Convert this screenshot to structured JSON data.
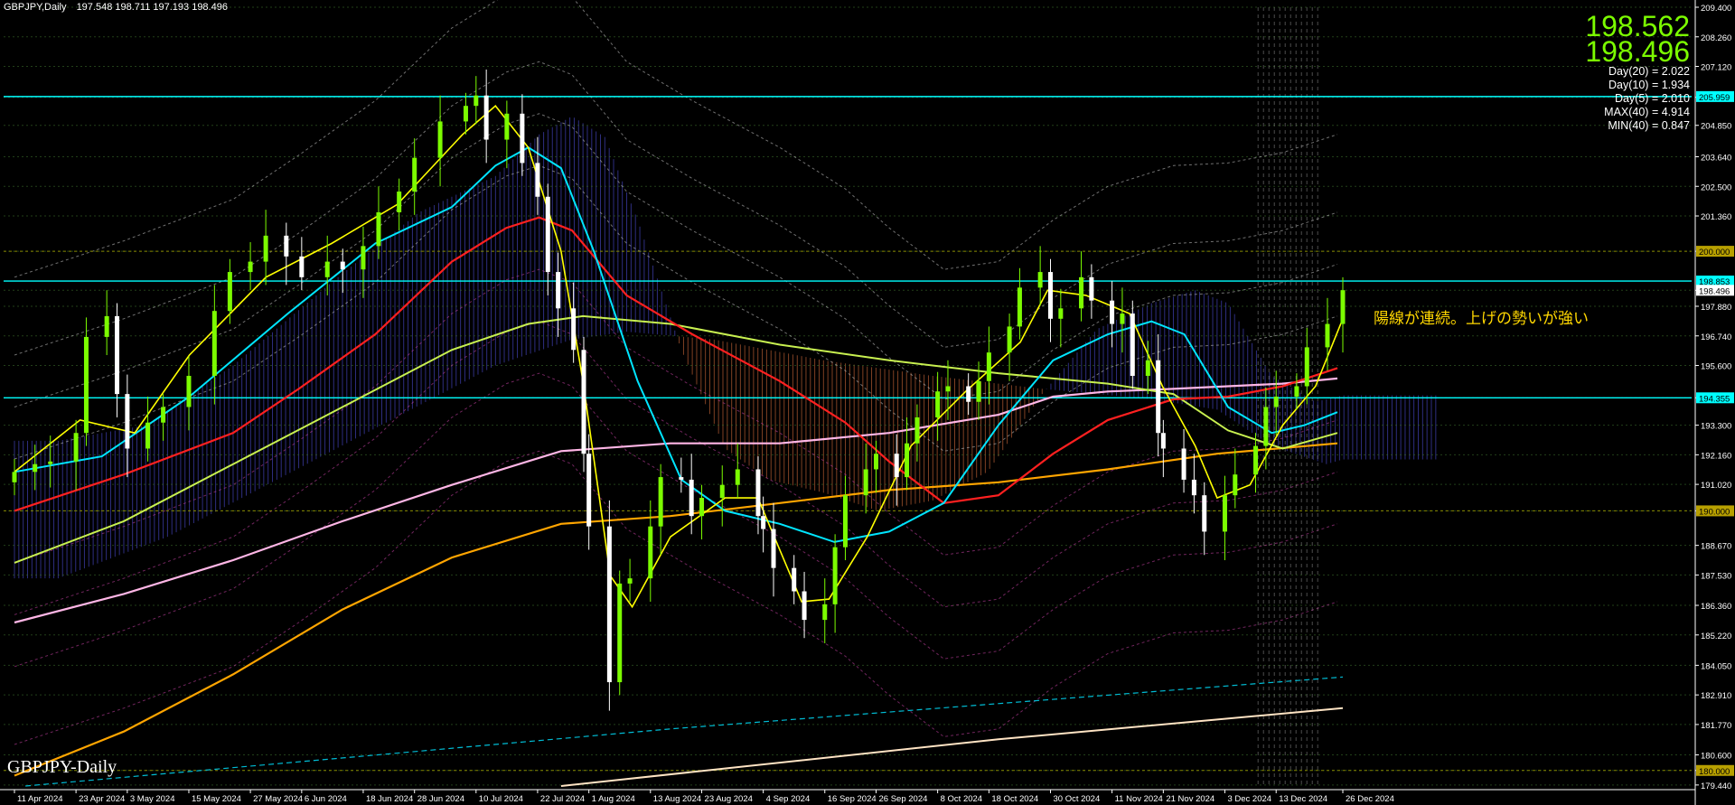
{
  "header": {
    "symbol": "GBPJPY,Daily",
    "ohlc": "197.548 198.711 197.193 198.496"
  },
  "price_box": {
    "bid": "198.562",
    "ask": "198.496"
  },
  "stats": [
    "Day(20) = 2.022",
    "Day(10) = 1.934",
    "Day(5) = 2.010",
    "MAX(40) = 4.914",
    "MIN(40) = 0.847"
  ],
  "annotation": "陽線が連続。上げの勢いが強い",
  "watermark": "GBPJPY-Daily",
  "colors": {
    "background": "#000000",
    "bull": "#7cfc00",
    "bear": "#ffffff",
    "sma_fast": "#ffff00",
    "sma_cyan": "#00e5ff",
    "sma_red": "#ff2020",
    "sma_lime": "#c8f050",
    "sma_pink": "#ffb6e6",
    "sma_orange": "#ffa500",
    "level_line": "#00ffff",
    "cloud_bull": "#3a3aa0",
    "cloud_bear": "#a0522d"
  },
  "chart_data": {
    "type": "candlestick",
    "symbol": "GBPJPY",
    "timeframe": "Daily",
    "ylim": [
      179.4,
      209.4
    ],
    "y_ticks": [
      "209.400",
      "208.260",
      "207.120",
      "205.930",
      "204.850",
      "203.640",
      "202.500",
      "201.360",
      "200.000",
      "198.496",
      "197.880",
      "196.740",
      "195.600",
      "194.355",
      "193.300",
      "192.160",
      "191.020",
      "190.000",
      "188.670",
      "187.530",
      "186.360",
      "185.220",
      "184.050",
      "182.910",
      "181.770",
      "180.600",
      "180.000",
      "179.440"
    ],
    "highlighted_levels": [
      "205.959",
      "200.000",
      "198.853",
      "198.496",
      "194.355",
      "190.000",
      "180.000"
    ],
    "x_labels": [
      "11 Apr 2024",
      "23 Apr 2024",
      "3 May 2024",
      "15 May 2024",
      "27 May 2024",
      "6 Jun 2024",
      "18 Jun 2024",
      "28 Jun 2024",
      "10 Jul 2024",
      "22 Jul 2024",
      "1 Aug 2024",
      "13 Aug 2024",
      "23 Aug 2024",
      "4 Sep 2024",
      "16 Sep 2024",
      "26 Sep 2024",
      "8 Oct 2024",
      "18 Oct 2024",
      "30 Oct 2024",
      "11 Nov 2024",
      "21 Nov 2024",
      "3 Dec 2024",
      "13 Dec 2024",
      "26 Dec 2024"
    ],
    "close_path": [
      [
        "11 Apr 2024",
        191.5
      ],
      [
        "15 Apr 2024",
        191.8
      ],
      [
        "18 Apr 2024",
        191.9
      ],
      [
        "23 Apr 2024",
        193.0
      ],
      [
        "25 Apr 2024",
        196.7
      ],
      [
        "29 Apr 2024",
        197.5
      ],
      [
        "1 May 2024",
        194.5
      ],
      [
        "3 May 2024",
        192.4
      ],
      [
        "7 May 2024",
        193.4
      ],
      [
        "10 May 2024",
        194.0
      ],
      [
        "15 May 2024",
        195.2
      ],
      [
        "20 May 2024",
        197.7
      ],
      [
        "23 May 2024",
        199.2
      ],
      [
        "27 May 2024",
        199.6
      ],
      [
        "30 May 2024",
        200.6
      ],
      [
        "3 Jun 2024",
        199.8
      ],
      [
        "6 Jun 2024",
        199.0
      ],
      [
        "11 Jun 2024",
        199.6
      ],
      [
        "14 Jun 2024",
        199.3
      ],
      [
        "18 Jun 2024",
        200.2
      ],
      [
        "21 Jun 2024",
        201.5
      ],
      [
        "25 Jun 2024",
        202.3
      ],
      [
        "28 Jun 2024",
        203.6
      ],
      [
        "3 Jul 2024",
        205.0
      ],
      [
        "8 Jul 2024",
        205.6
      ],
      [
        "10 Jul 2024",
        206.0
      ],
      [
        "12 Jul 2024",
        204.3
      ],
      [
        "16 Jul 2024",
        205.3
      ],
      [
        "19 Jul 2024",
        203.4
      ],
      [
        "22 Jul 2024",
        202.1
      ],
      [
        "24 Jul 2024",
        199.2
      ],
      [
        "26 Jul 2024",
        197.8
      ],
      [
        "29 Jul 2024",
        196.2
      ],
      [
        "31 Jul 2024",
        192.2
      ],
      [
        "1 Aug 2024",
        189.4
      ],
      [
        "5 Aug 2024",
        183.4
      ],
      [
        "7 Aug 2024",
        187.2
      ],
      [
        "9 Aug 2024",
        187.4
      ],
      [
        "13 Aug 2024",
        189.4
      ],
      [
        "15 Aug 2024",
        191.3
      ],
      [
        "19 Aug 2024",
        191.2
      ],
      [
        "21 Aug 2024",
        189.8
      ],
      [
        "23 Aug 2024",
        190.5
      ],
      [
        "27 Aug 2024",
        191.0
      ],
      [
        "30 Aug 2024",
        191.6
      ],
      [
        "3 Sep 2024",
        189.8
      ],
      [
        "4 Sep 2024",
        189.3
      ],
      [
        "6 Sep 2024",
        187.8
      ],
      [
        "10 Sep 2024",
        186.9
      ],
      [
        "12 Sep 2024",
        185.8
      ],
      [
        "16 Sep 2024",
        186.4
      ],
      [
        "18 Sep 2024",
        188.6
      ],
      [
        "20 Sep 2024",
        190.6
      ],
      [
        "24 Sep 2024",
        191.6
      ],
      [
        "26 Sep 2024",
        192.2
      ],
      [
        "30 Sep 2024",
        191.3
      ],
      [
        "2 Oct 2024",
        192.6
      ],
      [
        "4 Oct 2024",
        193.6
      ],
      [
        "8 Oct 2024",
        194.6
      ],
      [
        "10 Oct 2024",
        194.8
      ],
      [
        "14 Oct 2024",
        194.2
      ],
      [
        "16 Oct 2024",
        195.0
      ],
      [
        "18 Oct 2024",
        196.1
      ],
      [
        "22 Oct 2024",
        197.1
      ],
      [
        "24 Oct 2024",
        198.6
      ],
      [
        "28 Oct 2024",
        199.2
      ],
      [
        "30 Oct 2024",
        197.4
      ],
      [
        "1 Nov 2024",
        197.8
      ],
      [
        "5 Nov 2024",
        199.0
      ],
      [
        "7 Nov 2024",
        198.1
      ],
      [
        "11 Nov 2024",
        197.2
      ],
      [
        "13 Nov 2024",
        197.6
      ],
      [
        "15 Nov 2024",
        195.2
      ],
      [
        "18 Nov 2024",
        195.8
      ],
      [
        "20 Nov 2024",
        193.0
      ],
      [
        "21 Nov 2024",
        192.4
      ],
      [
        "25 Nov 2024",
        191.2
      ],
      [
        "27 Nov 2024",
        190.6
      ],
      [
        "29 Nov 2024",
        189.2
      ],
      [
        "3 Dec 2024",
        190.6
      ],
      [
        "5 Dec 2024",
        191.4
      ],
      [
        "9 Dec 2024",
        192.5
      ],
      [
        "11 Dec 2024",
        194.0
      ],
      [
        "13 Dec 2024",
        194.4
      ],
      [
        "17 Dec 2024",
        194.8
      ],
      [
        "19 Dec 2024",
        196.3
      ],
      [
        "23 Dec 2024",
        197.2
      ],
      [
        "26 Dec 2024",
        198.5
      ]
    ],
    "indicators": {
      "sma_fast_yellow": [
        [
          0,
          191.5
        ],
        [
          60,
          193.5
        ],
        [
          110,
          193.0
        ],
        [
          160,
          196.0
        ],
        [
          230,
          199.0
        ],
        [
          290,
          200.3
        ],
        [
          350,
          201.8
        ],
        [
          410,
          204.5
        ],
        [
          440,
          205.6
        ],
        [
          470,
          204.0
        ],
        [
          500,
          200.0
        ],
        [
          520,
          195.0
        ],
        [
          545,
          187.5
        ],
        [
          565,
          186.3
        ],
        [
          600,
          189.0
        ],
        [
          650,
          190.5
        ],
        [
          680,
          190.5
        ],
        [
          720,
          186.5
        ],
        [
          745,
          186.6
        ],
        [
          780,
          189.0
        ],
        [
          820,
          192.5
        ],
        [
          870,
          194.6
        ],
        [
          920,
          196.5
        ],
        [
          945,
          198.5
        ],
        [
          980,
          198.3
        ],
        [
          1020,
          197.6
        ],
        [
          1050,
          194.8
        ],
        [
          1080,
          192.5
        ],
        [
          1100,
          190.5
        ],
        [
          1130,
          191.0
        ],
        [
          1160,
          193.3
        ],
        [
          1190,
          194.8
        ],
        [
          1215,
          197.4
        ]
      ],
      "sma_cyan": [
        [
          0,
          191.5
        ],
        [
          80,
          192.1
        ],
        [
          160,
          194.4
        ],
        [
          250,
          197.6
        ],
        [
          330,
          200.3
        ],
        [
          400,
          201.7
        ],
        [
          440,
          203.3
        ],
        [
          470,
          204.0
        ],
        [
          500,
          203.2
        ],
        [
          530,
          200.0
        ],
        [
          570,
          195.0
        ],
        [
          610,
          191.2
        ],
        [
          650,
          190.0
        ],
        [
          700,
          189.5
        ],
        [
          750,
          188.8
        ],
        [
          800,
          189.2
        ],
        [
          850,
          190.3
        ],
        [
          900,
          193.3
        ],
        [
          950,
          195.8
        ],
        [
          1000,
          196.8
        ],
        [
          1040,
          197.3
        ],
        [
          1070,
          196.8
        ],
        [
          1110,
          194.0
        ],
        [
          1150,
          193.0
        ],
        [
          1180,
          193.3
        ],
        [
          1210,
          193.8
        ]
      ],
      "sma_red": [
        [
          0,
          190.0
        ],
        [
          100,
          191.4
        ],
        [
          200,
          193.0
        ],
        [
          260,
          194.7
        ],
        [
          330,
          196.8
        ],
        [
          400,
          199.6
        ],
        [
          450,
          200.9
        ],
        [
          480,
          201.3
        ],
        [
          510,
          200.8
        ],
        [
          560,
          198.3
        ],
        [
          620,
          196.8
        ],
        [
          700,
          195.0
        ],
        [
          760,
          193.4
        ],
        [
          800,
          191.9
        ],
        [
          850,
          190.3
        ],
        [
          900,
          190.6
        ],
        [
          950,
          192.2
        ],
        [
          1000,
          193.5
        ],
        [
          1060,
          194.3
        ],
        [
          1110,
          194.4
        ],
        [
          1160,
          194.8
        ],
        [
          1210,
          195.5
        ]
      ],
      "sma_lime": [
        [
          0,
          188.0
        ],
        [
          100,
          189.6
        ],
        [
          200,
          191.8
        ],
        [
          300,
          194.0
        ],
        [
          400,
          196.2
        ],
        [
          470,
          197.2
        ],
        [
          520,
          197.5
        ],
        [
          600,
          197.2
        ],
        [
          700,
          196.4
        ],
        [
          800,
          195.8
        ],
        [
          900,
          195.3
        ],
        [
          1000,
          194.9
        ],
        [
          1060,
          194.5
        ],
        [
          1110,
          193.1
        ],
        [
          1160,
          192.4
        ],
        [
          1210,
          193.0
        ]
      ],
      "sma_pink": [
        [
          0,
          185.7
        ],
        [
          100,
          186.8
        ],
        [
          200,
          188.1
        ],
        [
          300,
          189.6
        ],
        [
          400,
          191.0
        ],
        [
          500,
          192.3
        ],
        [
          600,
          192.6
        ],
        [
          700,
          192.6
        ],
        [
          800,
          193.0
        ],
        [
          900,
          193.7
        ],
        [
          950,
          194.4
        ],
        [
          1000,
          194.6
        ],
        [
          1060,
          194.7
        ],
        [
          1110,
          194.8
        ],
        [
          1160,
          194.9
        ],
        [
          1210,
          195.1
        ]
      ],
      "sma_orange": [
        [
          0,
          179.8
        ],
        [
          100,
          181.5
        ],
        [
          200,
          183.7
        ],
        [
          300,
          186.2
        ],
        [
          400,
          188.2
        ],
        [
          500,
          189.5
        ],
        [
          600,
          189.8
        ],
        [
          700,
          190.3
        ],
        [
          800,
          190.8
        ],
        [
          900,
          191.1
        ],
        [
          1000,
          191.6
        ],
        [
          1100,
          192.2
        ],
        [
          1210,
          192.6
        ]
      ]
    }
  }
}
